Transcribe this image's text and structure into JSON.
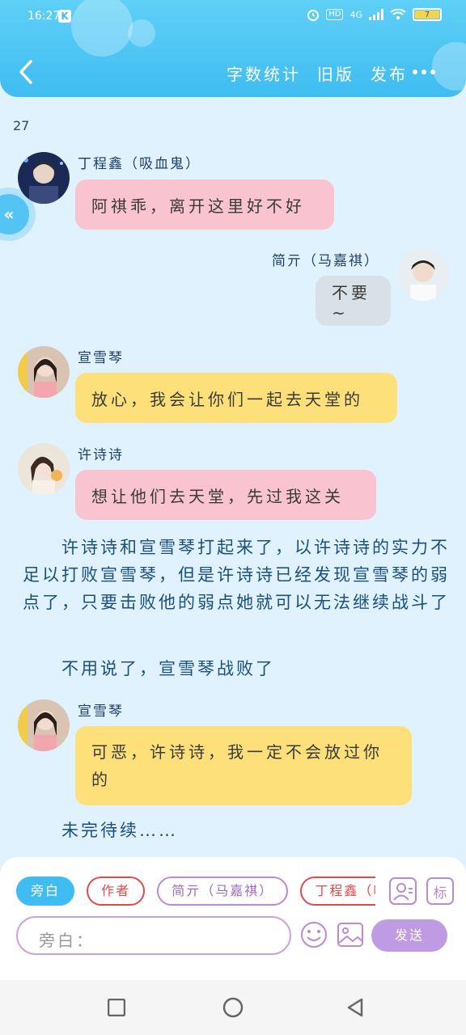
{
  "status_bar": {
    "time": "16:27",
    "app_badge": "K",
    "network_hd": "HD",
    "network_type": "4G",
    "battery_level": "7"
  },
  "header": {
    "actions": [
      "字数统计",
      "旧版",
      "发布"
    ]
  },
  "chapter_number": "27",
  "side_float_icon": "«",
  "messages": [
    {
      "name": "丁程鑫（吸血鬼）",
      "text": "阿祺乖，离开这里好不好"
    },
    {
      "name": "简亓（马嘉祺）",
      "text": "不要~"
    },
    {
      "name": "宣雪琴",
      "text": "放心，我会让你们一起去天堂的"
    },
    {
      "name": "许诗诗",
      "text": "想让他们去天堂，先过我这关"
    },
    {
      "name": "宣雪琴",
      "text": "可恶，许诗诗，我一定不会放过你的"
    }
  ],
  "narrations": [
    "　　许诗诗和宣雪琴打起来了，以许诗诗的实力不足以打败宣雪琴，但是许诗诗已经发现宣雪琴的弱点了，只要击败他的弱点她就可以无法继续战斗了",
    "　　不用说了，宣雪琴战败了",
    "　　未完待续……"
  ],
  "role_chips": [
    "旁白",
    "作者",
    "简亓（马嘉祺）",
    "丁程鑫（吸血"
  ],
  "tool_icons": {
    "tag_label": "标"
  },
  "input": {
    "prefix": "旁白："
  },
  "send_label": "发送",
  "colors": {
    "header": "#3fbcf1",
    "pink_bubble": "#f9c4cf",
    "yellow_bubble": "#fde079",
    "grey_bubble": "#d9e1e8",
    "send": "#bf9be3"
  }
}
